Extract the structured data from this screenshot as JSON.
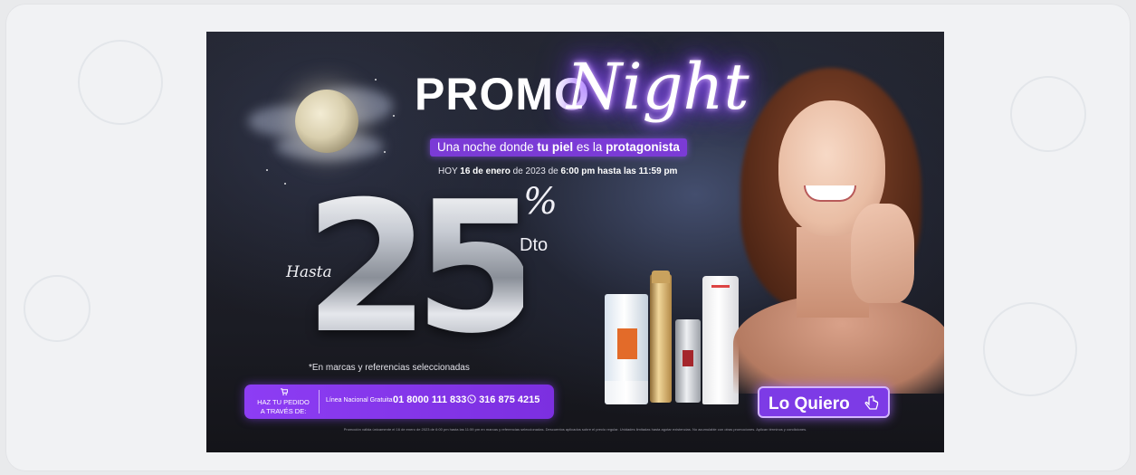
{
  "banner": {
    "title_promo": "PROMO",
    "title_night": "Night",
    "tagline_pre": "Una noche donde ",
    "tagline_bold1": "tu piel",
    "tagline_mid": " es la ",
    "tagline_bold2": "protagonista",
    "date_pre": "HOY ",
    "date_bold1": "16 de enero",
    "date_mid": " de 2023 de ",
    "date_bold2": "6:00 pm hasta las 11:59 pm",
    "hasta": "Hasta",
    "discount_value": "25",
    "percent_sign": "%",
    "dto": "Dto",
    "disclaimer": "*En marcas y referencias seleccionadas",
    "order": {
      "cta_line1": "HAZ TU PEDIDO",
      "cta_line2": "A TRAVÉS DE:",
      "line_label": "Línea Nacional Gratuita",
      "phone": "01 8000 111 833",
      "whatsapp": "316 875 4215"
    },
    "button_label": "Lo Quiero",
    "fine_print": "Promoción válida únicamente el 16 de enero de 2023 de 6:00 pm hasta las 11:59 pm en marcas y referencias seleccionadas. Descuentos aplicados sobre el precio regular. Unidades limitadas hasta agotar existencias. No acumulable con otras promociones. Aplican términos y condiciones."
  },
  "colors": {
    "accent_purple": "#7d3be6",
    "neon_glow": "#a76cff",
    "background_dark": "#1b1c24"
  }
}
